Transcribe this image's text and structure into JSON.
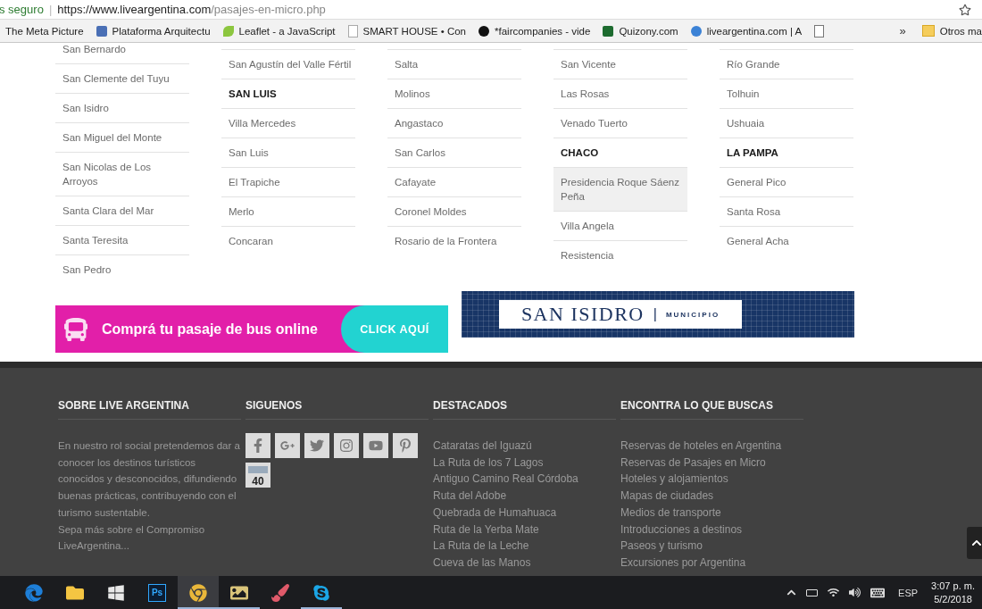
{
  "browser": {
    "security": "s seguro",
    "separator": "|",
    "url_host": "https://www.liveargentina.com",
    "url_path": "/pasajes-en-micro.php"
  },
  "bookmarks": [
    {
      "label": "The Meta Picture"
    },
    {
      "label": "Plataforma Arquitectu"
    },
    {
      "label": "Leaflet - a JavaScript"
    },
    {
      "label": "SMART HOUSE • Con"
    },
    {
      "label": "*faircompanies - vide"
    },
    {
      "label": "Quizony.com"
    },
    {
      "label": "liveargentina.com | A"
    }
  ],
  "bookmarks_more": "»",
  "other_bookmarks": "Otros ma",
  "destinations": [
    {
      "items": [
        {
          "label": "San Bernardo",
          "kind": "city",
          "hovered": false
        },
        {
          "label": "San Clemente del Tuyu",
          "kind": "city",
          "hovered": false
        },
        {
          "label": "San Isidro",
          "kind": "city",
          "hovered": false
        },
        {
          "label": "San Miguel del Monte",
          "kind": "city",
          "hovered": false
        },
        {
          "label": "San Nicolas de Los Arroyos",
          "kind": "city",
          "hovered": false
        },
        {
          "label": "Santa Clara del Mar",
          "kind": "city",
          "hovered": false
        },
        {
          "label": "Santa Teresita",
          "kind": "city",
          "hovered": false
        },
        {
          "label": "San Pedro",
          "kind": "city",
          "hovered": false
        }
      ]
    },
    {
      "items": [
        {
          "label": "San Agustín del Valle Fértil",
          "kind": "city",
          "hovered": false
        },
        {
          "label": "SAN LUIS",
          "kind": "province",
          "hovered": false
        },
        {
          "label": "Villa Mercedes",
          "kind": "city",
          "hovered": false
        },
        {
          "label": "San Luis",
          "kind": "city",
          "hovered": false
        },
        {
          "label": "El Trapiche",
          "kind": "city",
          "hovered": false
        },
        {
          "label": "Merlo",
          "kind": "city",
          "hovered": false
        },
        {
          "label": "Concaran",
          "kind": "city",
          "hovered": false
        }
      ]
    },
    {
      "items": [
        {
          "label": "Salta",
          "kind": "city",
          "hovered": false
        },
        {
          "label": "Molinos",
          "kind": "city",
          "hovered": false
        },
        {
          "label": "Angastaco",
          "kind": "city",
          "hovered": false
        },
        {
          "label": "San Carlos",
          "kind": "city",
          "hovered": false
        },
        {
          "label": "Cafayate",
          "kind": "city",
          "hovered": false
        },
        {
          "label": "Coronel Moldes",
          "kind": "city",
          "hovered": false
        },
        {
          "label": "Rosario de la Frontera",
          "kind": "city",
          "hovered": false
        }
      ]
    },
    {
      "items": [
        {
          "label": "San Vicente",
          "kind": "city",
          "hovered": false
        },
        {
          "label": "Las Rosas",
          "kind": "city",
          "hovered": false
        },
        {
          "label": "Venado Tuerto",
          "kind": "city",
          "hovered": false
        },
        {
          "label": "CHACO",
          "kind": "province",
          "hovered": false
        },
        {
          "label": "Presidencia Roque Sáenz Peña",
          "kind": "city",
          "hovered": true
        },
        {
          "label": "Villa Angela",
          "kind": "city",
          "hovered": false
        },
        {
          "label": "Resistencia",
          "kind": "city",
          "hovered": false
        }
      ]
    },
    {
      "items": [
        {
          "label": "Río Grande",
          "kind": "city",
          "hovered": false
        },
        {
          "label": "Tolhuin",
          "kind": "city",
          "hovered": false
        },
        {
          "label": "Ushuaia",
          "kind": "city",
          "hovered": false
        },
        {
          "label": "LA PAMPA",
          "kind": "province",
          "hovered": false
        },
        {
          "label": "General Pico",
          "kind": "city",
          "hovered": false
        },
        {
          "label": "Santa Rosa",
          "kind": "city",
          "hovered": false
        },
        {
          "label": "General Acha",
          "kind": "city",
          "hovered": false
        }
      ]
    }
  ],
  "banners": {
    "bus": {
      "text": "Comprá tu pasaje de bus online",
      "action": "CLICK AQUÍ"
    },
    "municipio": {
      "name": "SAN ISIDRO",
      "separator": "|",
      "subtitle": "MUNICIPIO"
    }
  },
  "footer": {
    "columns": [
      {
        "kind": "about",
        "heading": "SOBRE LIVE ARGENTINA",
        "paragraph": "En nuestro rol social pretendemos dar a conocer los destinos turísticos conocidos y desconocidos, difundiendo buenas prácticas, contribuyendo con el turismo sustentable.",
        "links": [
          "Sepa más sobre el Compromiso LiveArgentina..."
        ]
      },
      {
        "kind": "social",
        "heading": "SIGUENOS",
        "route_badge": "40"
      },
      {
        "kind": "links",
        "heading": "DESTACADOS",
        "links": [
          "Cataratas del Iguazú",
          "La Ruta de los 7 Lagos",
          "Antiguo Camino Real Córdoba",
          "Ruta del Adobe",
          "Quebrada de Humahuaca",
          "Ruta de la Yerba Mate",
          "La Ruta de la Leche",
          "Cueva de las Manos"
        ]
      },
      {
        "kind": "links",
        "heading": "ENCONTRA LO QUE BUSCAS",
        "links": [
          "Reservas de hoteles en Argentina",
          "Reservas de Pasajes en Micro",
          "Hoteles y alojamientos",
          "Mapas de ciudades",
          "Medios de transporte",
          "Introducciones a destinos",
          "Paseos y turismo",
          "Excursiones por Argentina"
        ]
      }
    ]
  },
  "taskbar": {
    "apps": [
      {
        "kind": "edge",
        "active": false,
        "running": false
      },
      {
        "kind": "folder",
        "active": false,
        "running": false
      },
      {
        "kind": "store",
        "active": false,
        "running": false
      },
      {
        "kind": "photoshop",
        "label": "Ps",
        "active": false,
        "running": false
      },
      {
        "kind": "chrome",
        "active": true,
        "running": true
      },
      {
        "kind": "viewer",
        "active": false,
        "running": true
      },
      {
        "kind": "paint",
        "active": false,
        "running": false
      },
      {
        "kind": "skype",
        "active": false,
        "running": true
      }
    ],
    "language": "ESP",
    "time": "3:07 p. m.",
    "date": "5/2/2018"
  }
}
